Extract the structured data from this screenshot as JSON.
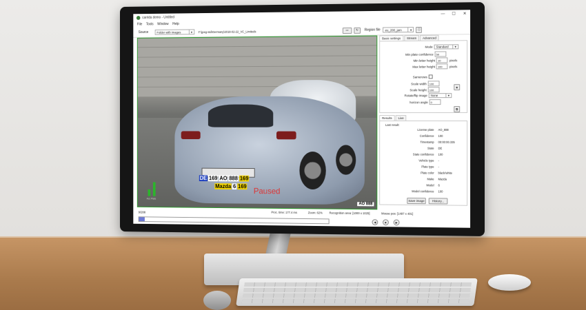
{
  "window": {
    "title": "carrida demo - Untitled",
    "controls": [
      "—",
      "☐",
      "✕"
    ]
  },
  "menu": [
    "File",
    "Tools",
    "Window",
    "Help"
  ],
  "toolbar": {
    "source_label": "Source",
    "source_value": "Folder with images",
    "path": "F:\\jpeg-std\\Germany\\2018-02-22_VC_Limiteds",
    "region_label": "Region file",
    "region_value": "eu_200_jam"
  },
  "right_tabs": [
    "Basic settings",
    "Stream",
    "Advanced"
  ],
  "settings": {
    "mode_label": "Mode",
    "mode_value": "Standard",
    "min_conf_label": "Min plate confidence",
    "min_conf_value": "50",
    "min_letter_label": "Min letter height",
    "min_letter_value": "10",
    "min_letter_unit": "pixels",
    "max_letter_label": "Max letter height",
    "max_letter_value": "100",
    "max_letter_unit": "pixels",
    "samerows_label": "Samerows",
    "scale_width_label": "Scale width",
    "scale_width_value": "100",
    "scale_height_label": "Scale height",
    "scale_height_value": "100",
    "rotate_label": "Rotate/flip image",
    "rotate_value": "None",
    "horizon_label": "horizon angle",
    "horizon_value": "0"
  },
  "result_tabs": [
    "Results",
    "Live"
  ],
  "results": {
    "heading": "Last result:",
    "rows": [
      {
        "k": "License plate",
        "v": "AO_888"
      },
      {
        "k": "Confidence",
        "v": "100"
      },
      {
        "k": "Timestamp",
        "v": "00:00:00.335"
      },
      {
        "k": "State",
        "v": "DE"
      },
      {
        "k": "State confidence",
        "v": "100"
      },
      {
        "k": "Vehicle type",
        "v": "-"
      },
      {
        "k": "Plate type",
        "v": "-"
      },
      {
        "k": "Plate color",
        "v": "black/white"
      },
      {
        "k": "Make",
        "v": "Mazda"
      },
      {
        "k": "Model",
        "v": "6"
      },
      {
        "k": "Model confidence",
        "v": "100"
      }
    ],
    "save_image": "Save image",
    "history": "History..."
  },
  "video": {
    "paused": "Paused",
    "plate_country": "DE",
    "plate_tokens": [
      "169",
      "AO",
      "888",
      "169"
    ],
    "make_model": [
      "Mazda",
      "6",
      "169"
    ],
    "snippet": "AO 888",
    "levels_label": "Acc  Plate",
    "level_values": [
      0.35,
      0.75
    ]
  },
  "status": {
    "proc_time": "Proc. time: 177.4 ms",
    "zoom": "Zoom: 62%",
    "recog_area": "Recognition area: [1000 x 1025]",
    "mouse_pos": "Mouse pos: [1497 x 401]"
  },
  "bottom": {
    "counter": "9/288",
    "progress": 0.03
  },
  "colors": {
    "accent": "#2c9c2c",
    "paused": "#dd3333",
    "progress": "#6e7bd6"
  }
}
